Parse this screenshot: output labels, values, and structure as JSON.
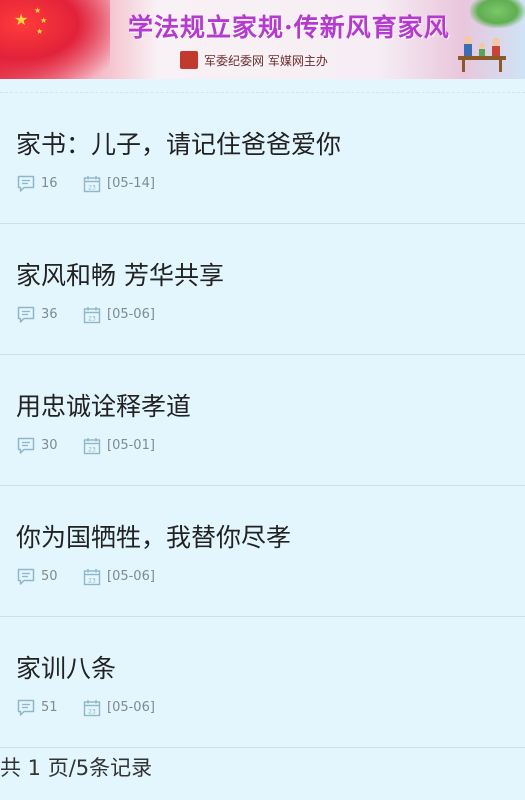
{
  "banner": {
    "title": "学法规立家规·传新风育家风",
    "subtitle": "军委纪委网 军媒网主办"
  },
  "articles": [
    {
      "title": "家书：儿子，请记住爸爸爱你",
      "comments": "16",
      "date": "[05-14]"
    },
    {
      "title": "家风和畅 芳华共享",
      "comments": "36",
      "date": "[05-06]"
    },
    {
      "title": "用忠诚诠释孝道",
      "comments": "30",
      "date": "[05-01]"
    },
    {
      "title": "你为国牺牲，我替你尽孝",
      "comments": "50",
      "date": "[05-06]"
    },
    {
      "title": "家训八条",
      "comments": "51",
      "date": "[05-06]"
    }
  ],
  "pagination": {
    "summary": "共 1 页/5条记录"
  },
  "icons": {
    "comment": "comment-icon",
    "date": "calendar-icon"
  },
  "colors": {
    "background": "#e3f6fd",
    "divider": "#c9e3ee",
    "title_text": "#222222",
    "meta_text": "#7f8a92"
  }
}
